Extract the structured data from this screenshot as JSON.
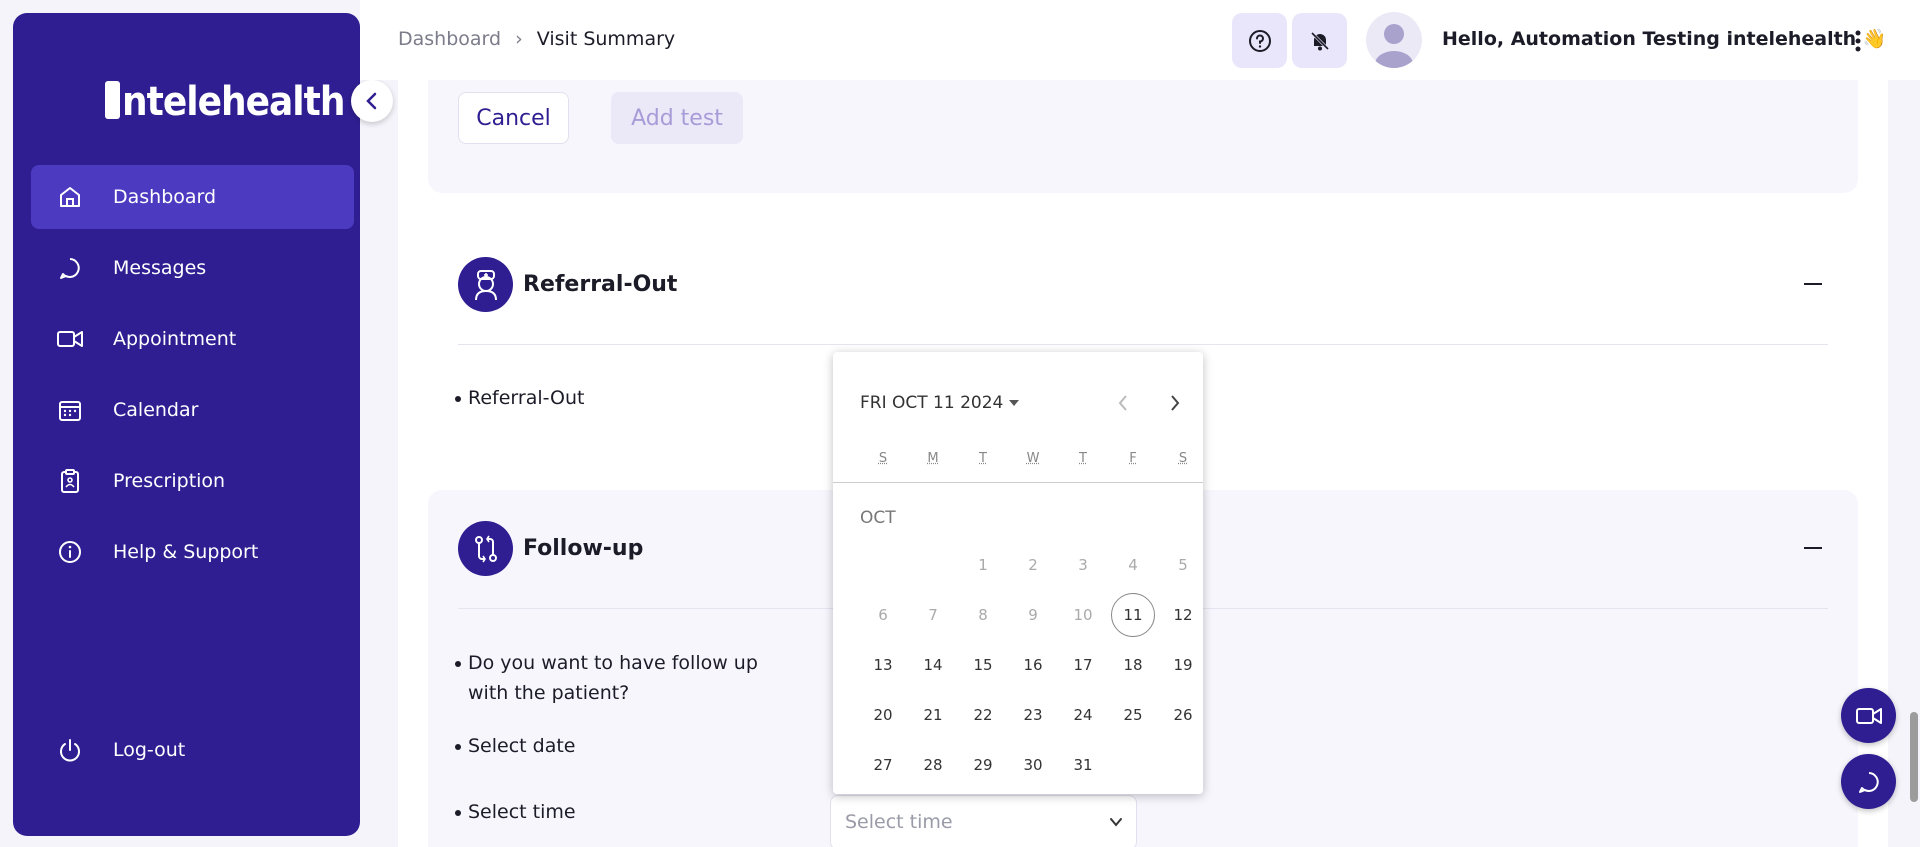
{
  "app": {
    "logo_text": "intelehealth"
  },
  "sidebar": {
    "items": [
      {
        "label": "Dashboard",
        "icon": "home-icon",
        "active": true
      },
      {
        "label": "Messages",
        "icon": "chat-bubble-icon"
      },
      {
        "label": "Appointment",
        "icon": "video-camera-icon"
      },
      {
        "label": "Calendar",
        "icon": "calendar-icon"
      },
      {
        "label": "Prescription",
        "icon": "clipboard-icon"
      },
      {
        "label": "Help & Support",
        "icon": "info-icon"
      }
    ],
    "logout_label": "Log-out"
  },
  "header": {
    "breadcrumb": {
      "root": "Dashboard",
      "current": "Visit Summary"
    },
    "greeting": "Hello, Automation Testing intelehealth",
    "greeting_emoji": "👋"
  },
  "test_section": {
    "cancel_label": "Cancel",
    "add_label": "Add test"
  },
  "referral": {
    "title": "Referral-Out",
    "item": "Referral-Out"
  },
  "followup": {
    "title": "Follow-up",
    "question": "Do you want to have follow up with the patient?",
    "select_date_label": "Select date",
    "select_time_label": "Select time",
    "time_placeholder": "Select time"
  },
  "calendar": {
    "period_label": "FRI OCT 11 2024",
    "weekdays": [
      "S",
      "M",
      "T",
      "W",
      "T",
      "F",
      "S"
    ],
    "month_label": "OCT",
    "today": 11,
    "first_weekday": 2,
    "days_in_month": 31,
    "min_enabled_day": 11
  },
  "colors": {
    "primary": "#2e1e91",
    "active_nav": "#4c3bc0",
    "light_bg": "#f7f6fd"
  }
}
